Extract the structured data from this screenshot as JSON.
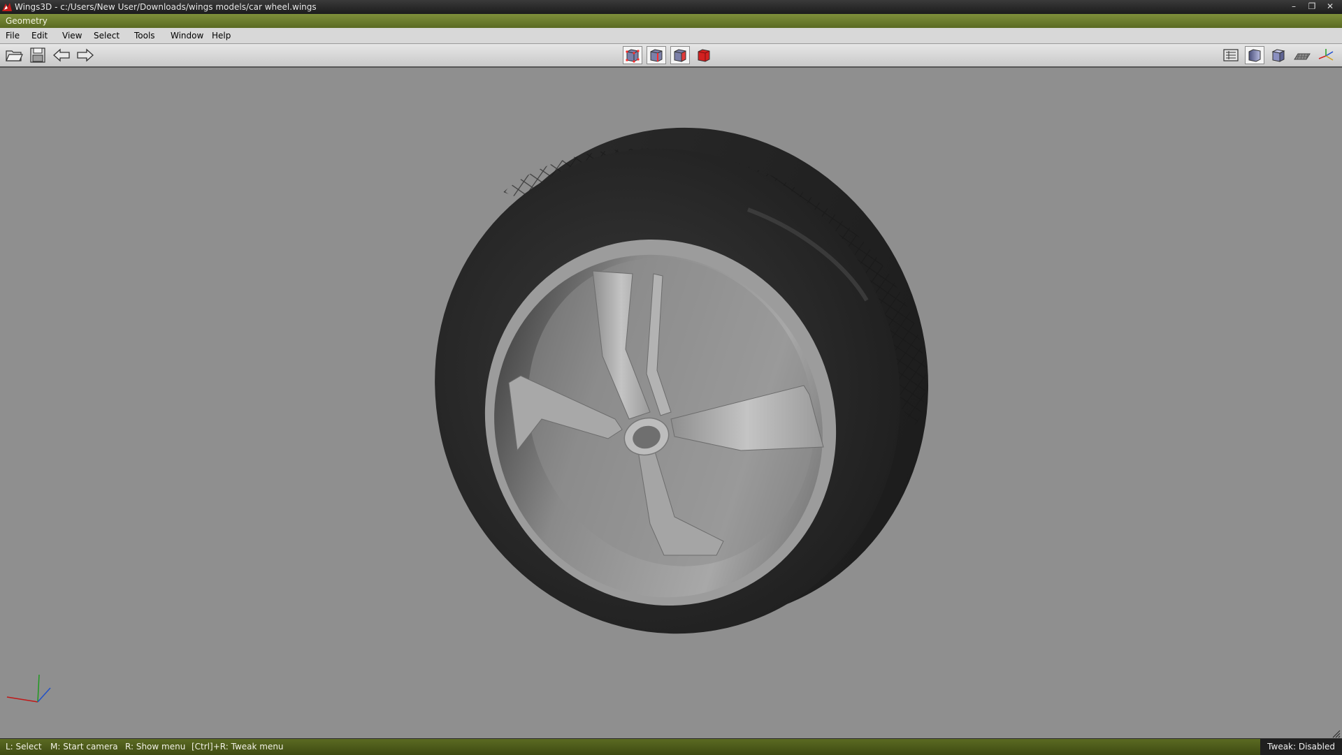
{
  "window": {
    "title": "Wings3D - c:/Users/New User/Downloads/wings models/car wheel.wings",
    "minimize_label": "–",
    "maximize_label": "❐",
    "close_label": "✕"
  },
  "geometry_bar": {
    "label": "Geometry"
  },
  "menu": {
    "items": [
      "File",
      "Edit",
      "View",
      "Select",
      "Tools",
      "Window",
      "Help"
    ]
  },
  "toolbar": {
    "left": [
      {
        "icon": "open-folder-icon"
      },
      {
        "icon": "save-icon"
      },
      {
        "icon": "undo-arrow-icon"
      },
      {
        "icon": "redo-arrow-icon"
      }
    ],
    "selection_modes": [
      {
        "icon": "vertex-select-icon",
        "pressed": true
      },
      {
        "icon": "edge-select-icon",
        "pressed": true
      },
      {
        "icon": "face-select-icon",
        "pressed": true
      },
      {
        "icon": "body-select-icon",
        "pressed": false,
        "color": "#d22020"
      }
    ],
    "right": [
      {
        "icon": "wireframe-overlay-icon",
        "pressed": false
      },
      {
        "icon": "smooth-shaded-icon",
        "pressed": true
      },
      {
        "icon": "flat-shaded-icon",
        "pressed": false
      },
      {
        "icon": "ground-plane-icon",
        "pressed": false
      },
      {
        "icon": "axes-toggle-icon",
        "pressed": false
      }
    ]
  },
  "viewport": {
    "background": "#8f8f8f",
    "tire_color": "#262626",
    "rim_color": "#a8a8a8"
  },
  "status_bar": {
    "hints": [
      "L: Select",
      "M: Start camera",
      "R: Show menu",
      "[Ctrl]+R: Tweak menu"
    ],
    "tweak": "Tweak: Disabled"
  }
}
